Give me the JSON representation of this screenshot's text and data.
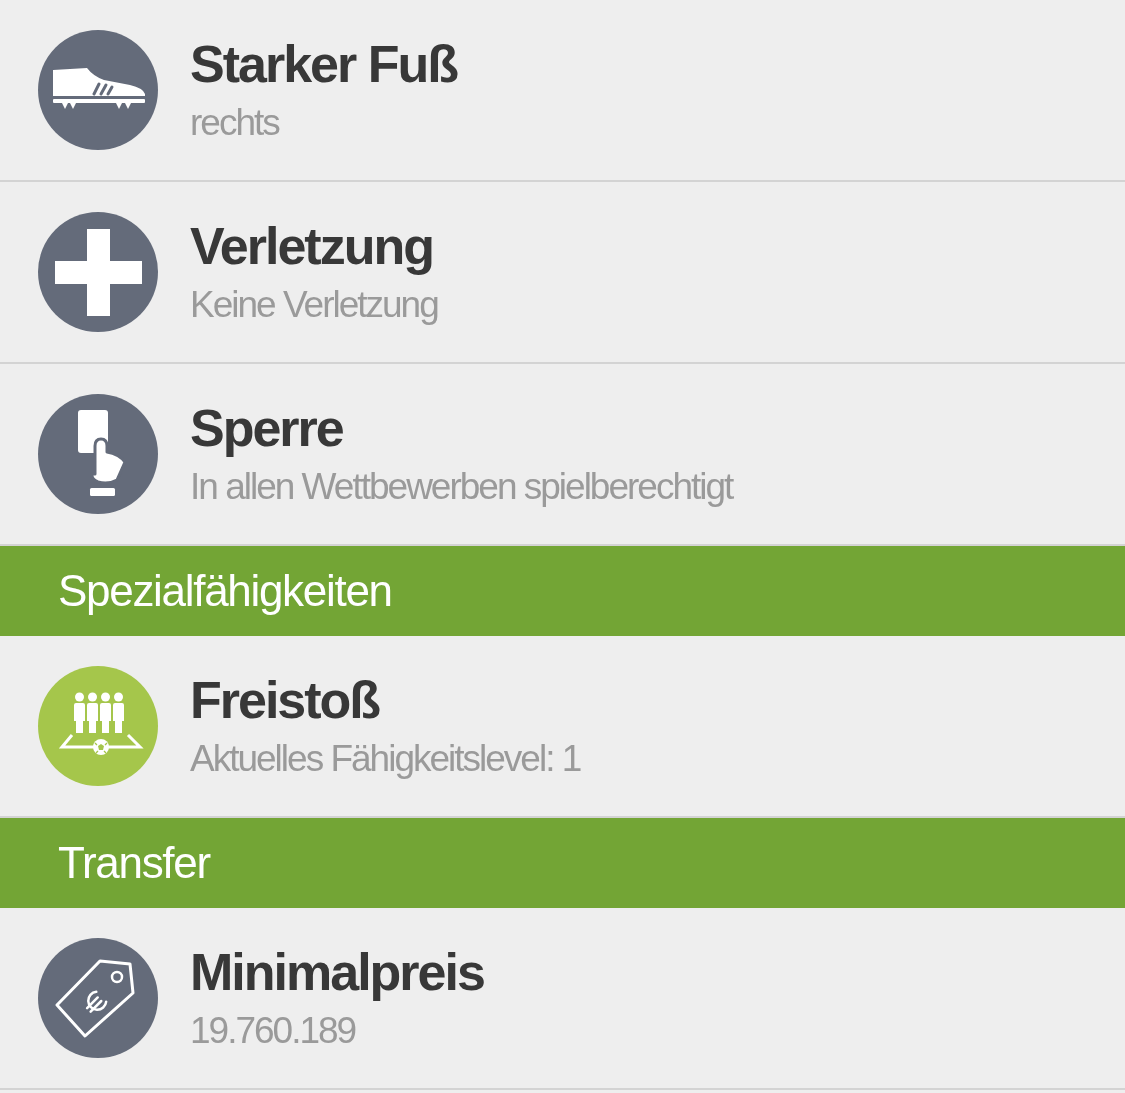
{
  "items": [
    {
      "kind": "row",
      "title": "Starker Fuß",
      "subtitle": "rechts",
      "color": "#646b7a"
    },
    {
      "kind": "row",
      "title": "Verletzung",
      "subtitle": "Keine Verletzung",
      "color": "#646b7a"
    },
    {
      "kind": "row",
      "title": "Sperre",
      "subtitle": "In allen Wettbewerben spielberechtigt",
      "color": "#646b7a"
    },
    {
      "kind": "header",
      "label": "Spezialfähigkeiten"
    },
    {
      "kind": "row",
      "title": "Freistoß",
      "subtitle": "Aktuelles Fähigkeitslevel: 1",
      "color": "#a5c64b"
    },
    {
      "kind": "header",
      "label": "Transfer"
    },
    {
      "kind": "row",
      "title": "Minimalpreis",
      "subtitle": "19.760.189",
      "color": "#646b7a"
    }
  ]
}
